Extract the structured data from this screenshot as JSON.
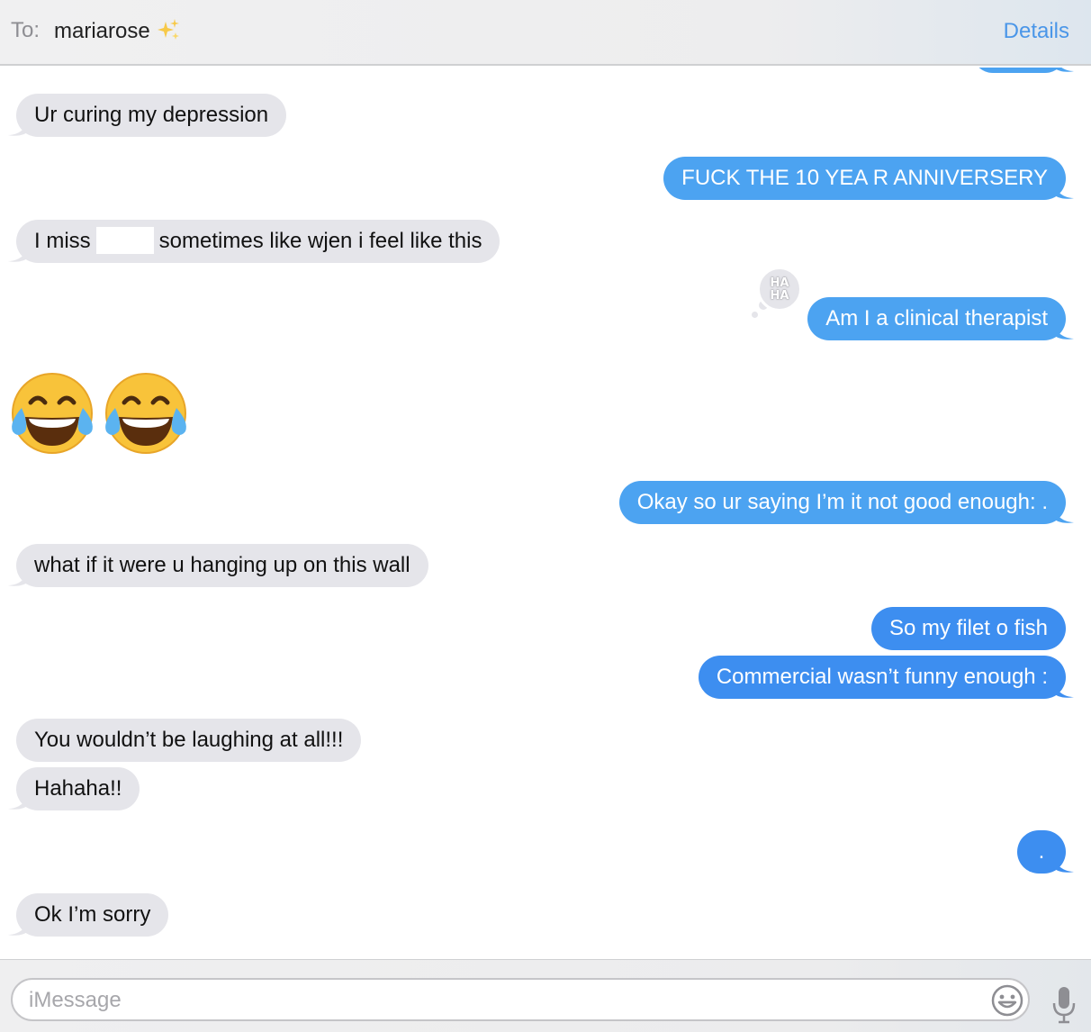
{
  "header": {
    "to_label": "To:",
    "recipient": "mariarose",
    "recipient_emoji": "sparkles-icon",
    "details_label": "Details"
  },
  "messages": [
    {
      "direction": "received",
      "text": "Ur curing my depression"
    },
    {
      "direction": "sent",
      "text": "FUCK THE 10 YEA R ANNIVERSERY"
    },
    {
      "direction": "received",
      "text_before": "I miss",
      "text_after": "sometimes like wjen i feel like this",
      "redacted": true
    },
    {
      "direction": "sent",
      "text": "Am I a clinical therapist",
      "tapback": "HA HA"
    },
    {
      "direction": "received",
      "emoji": "face-with-tears-of-joy x2"
    },
    {
      "direction": "sent",
      "text": "Okay so ur saying I’m it not good enough: ."
    },
    {
      "direction": "received",
      "text": "what if it were u hanging up on this wall"
    },
    {
      "direction": "sent",
      "text": "So my filet o fish"
    },
    {
      "direction": "sent",
      "text": "Commercial wasn’t funny enough :"
    },
    {
      "direction": "received",
      "text": "You wouldn’t be laughing at all!!!"
    },
    {
      "direction": "received",
      "text": "Hahaha!!"
    },
    {
      "direction": "sent",
      "text": "."
    },
    {
      "direction": "received",
      "text": "Ok I’m sorry"
    }
  ],
  "tapback": {
    "line1": "HA",
    "line2": "HA"
  },
  "composer": {
    "placeholder": "iMessage",
    "emoji_button_icon": "smiley-icon",
    "mic_icon": "microphone-icon"
  },
  "colors": {
    "sent_bubble": "#4ca3f1",
    "received_bubble": "#e5e5ea",
    "accent": "#4a96e8"
  }
}
